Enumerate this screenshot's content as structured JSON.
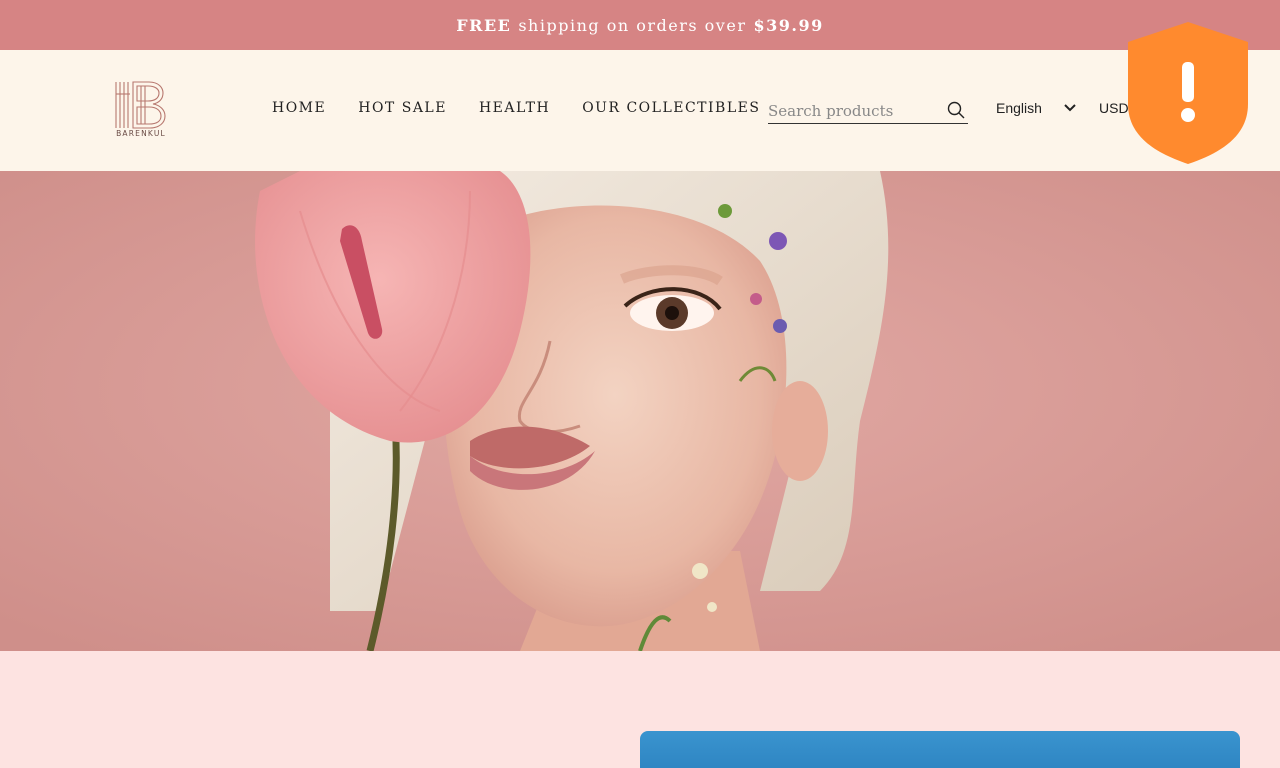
{
  "announcement": {
    "bold": "FREE",
    "text": "shipping on orders over",
    "amount": "$39.99"
  },
  "header": {
    "logo_text": "BARENKUL",
    "nav": [
      "HOME",
      "HOT SALE",
      "HEALTH",
      "OUR COLLECTIBLES"
    ],
    "search_placeholder": "Search products",
    "language": "English",
    "currency": "USD"
  },
  "hero": {
    "image": "model-with-pink-anthurium-flower"
  },
  "security": {
    "icon": "shield-alert-icon",
    "color": "#ff8a2e"
  },
  "colors": {
    "announcement_bg": "#d68484",
    "header_bg": "#fdf5ea",
    "page_bg": "#fde3e1",
    "hero_bg": "#d99a95"
  }
}
